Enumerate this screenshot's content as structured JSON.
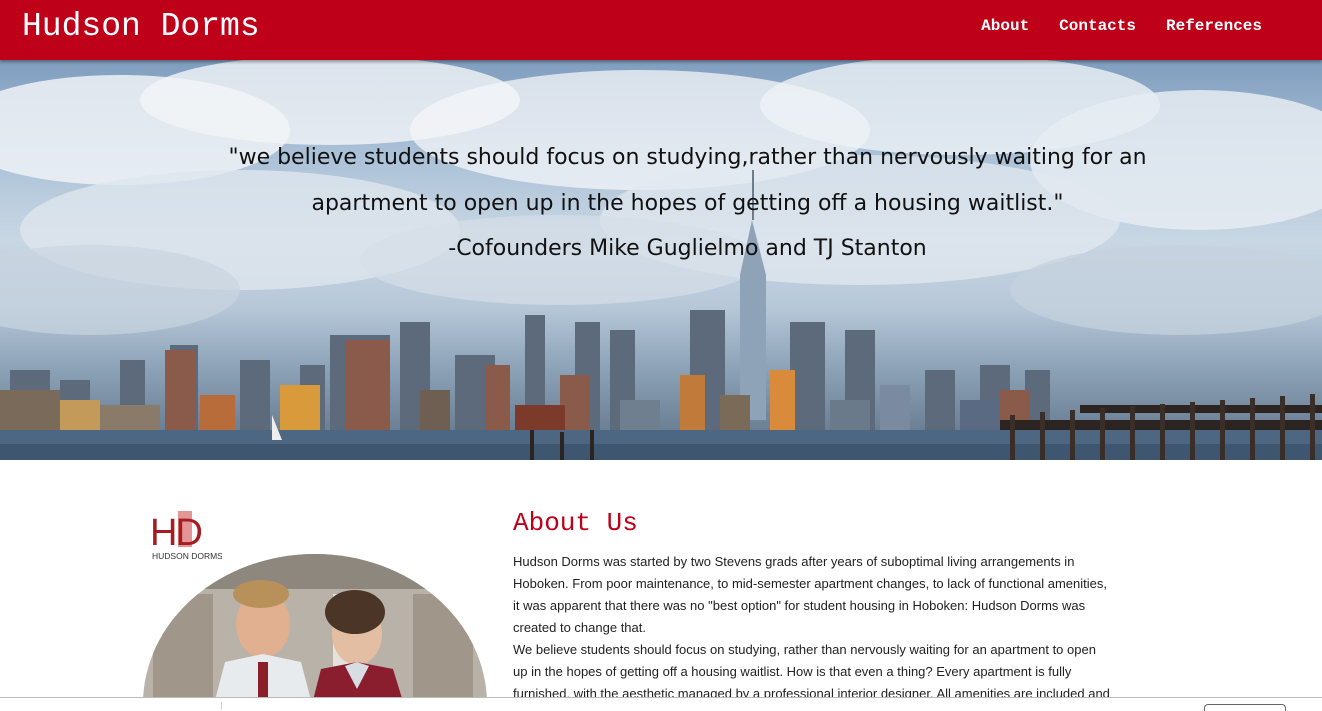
{
  "navbar": {
    "brand": "Hudson Dorms",
    "links": [
      "About",
      "Contacts",
      "References"
    ]
  },
  "hero": {
    "quote": "\"we believe students should focus on studying,rather than nervously waiting for an apartment to open up in the hopes of getting off a housing waitlist.\"",
    "author": "-Cofounders Mike Guglielmo and TJ Stanton"
  },
  "logo": {
    "letters": "HD",
    "caption": "HUDSON DORMS"
  },
  "about": {
    "title": "About Us",
    "p1": "Hudson Dorms was started by two Stevens grads after years of suboptimal living arrangements in Hoboken. From poor maintenance, to mid-semester apartment changes, to lack of functional amenities, it was apparent that there was no \"best option\" for student housing in Hoboken: Hudson Dorms was created to change that.",
    "p2": "We believe students should focus on studying, rather than nervously waiting for an apartment to open up in the hopes of getting off a housing waitlist. How is that even a thing? Every apartment is fully furnished, with the aesthetic managed by a professional interior designer. All amenities are included and"
  },
  "colors": {
    "brand_red": "#be0019",
    "white": "#ffffff"
  }
}
